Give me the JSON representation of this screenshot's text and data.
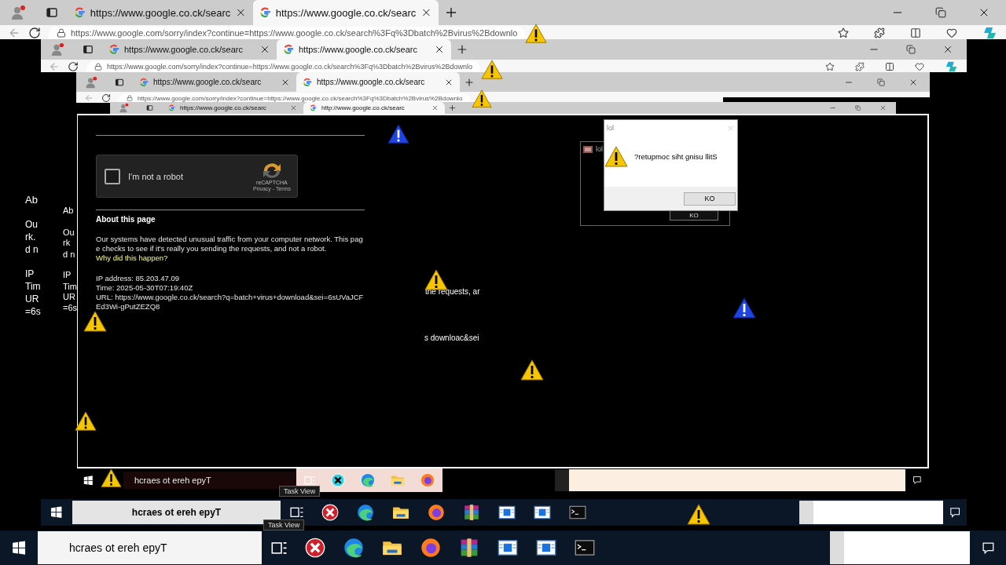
{
  "windows": [
    {
      "tabs": [
        {
          "title": "https://www.google.co.ck/searc",
          "selected": false
        },
        {
          "title": "https://www.google.co.ck/searc",
          "selected": true
        }
      ],
      "address": "https://www.google.com/sorry/index?continue=https://www.google.co.ck/search%3Fq%3Dbatch%2Bvirus%2Bdownlo"
    },
    {
      "tabs": [
        {
          "title": "https://www.google.co.ck/searc",
          "selected": false
        },
        {
          "title": "https://www.google.co.ck/searc",
          "selected": true
        }
      ],
      "address": "https://www.google.com/sorry/index?continue=https://www.google.co.ck/search%3Fq%3Dbatch%2Bvirus%2Bdownlo"
    },
    {
      "tabs": [
        {
          "title": "https://www.google.co.ck/searc",
          "selected": false
        },
        {
          "title": "https://www.google.co.ck/searc",
          "selected": true
        }
      ],
      "address": "https://www.google.com/sorry/index?continue=https://www.google.co.ck/search%3Fq%3Dbatch%2Bvirus%2Bdownlo"
    },
    {
      "tabs": [
        {
          "title": "https://www.google.co.ck/searc",
          "selected": false
        },
        {
          "title": "http://www.google.co.ck/searc",
          "selected": true
        }
      ]
    }
  ],
  "page": {
    "captcha": {
      "label": "I'm not a robot",
      "checked": false,
      "brand": "reCAPTCHA",
      "links": "Privacy - Terms"
    },
    "heading": "About this page",
    "paragraph": "Our systems have detected unusual traffic from your computer network. This page checks to see if it's really you sending the requests, and not a robot.",
    "link": "Why did this happen?",
    "details": [
      "IP address: 85.203.47.09",
      "Time: 2025-05-30T07:19:40Z",
      "URL: https://www.google.co.ck/search?q=batch+virus+download&sei=6sUVaJCFEd3Wi-gPutZEZQ8"
    ]
  },
  "fragments": [
    "Ab",
    "Ou",
    "rk.",
    "d n",
    "IP",
    "Tim",
    "UR",
    "=6s",
    "Ab",
    "Ou",
    "rk",
    "d n",
    "IP",
    "Tim",
    "UR",
    "=6s",
    "the requests, ar",
    "s downloac&sei"
  ],
  "dialogs": [
    {
      "kind": "front",
      "title": "lol",
      "message": "?retupmoc siht gnisu llitS",
      "button": "KO"
    },
    {
      "kind": "back",
      "title": "lol",
      "button": "KO"
    }
  ],
  "taskbars": [
    {
      "search": "hcraes ot ereh epyT",
      "tooltip": "Task View"
    },
    {
      "search": "hcraes ot ereh epyT",
      "tooltip": "Task View"
    },
    {
      "search": "hcraes ot ereh epyT"
    }
  ]
}
